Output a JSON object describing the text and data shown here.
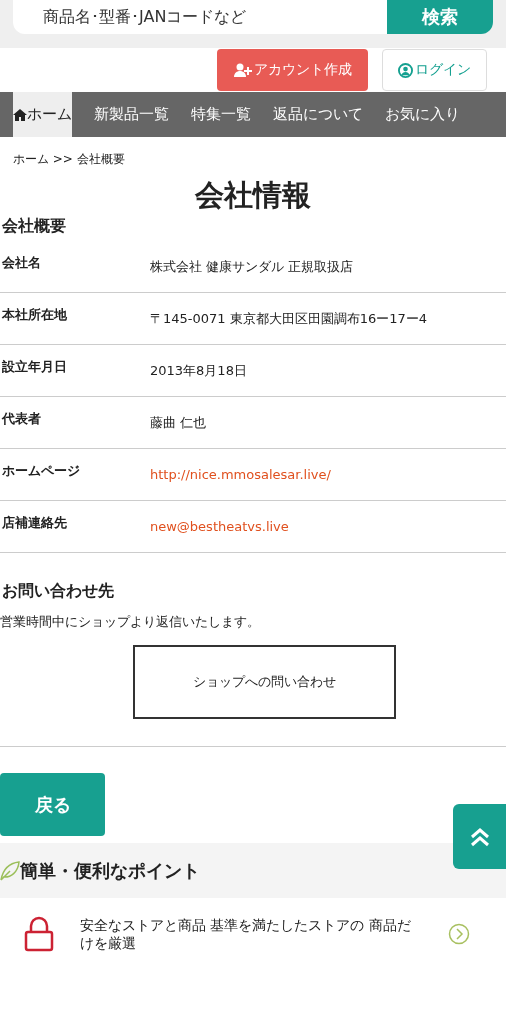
{
  "search": {
    "placeholder": "商品名･型番･JANコードなど",
    "button": "検索"
  },
  "account": {
    "create": "アカウント作成",
    "login": "ログイン"
  },
  "nav": [
    {
      "label": "ホーム",
      "selected": true,
      "icon": true
    },
    {
      "label": "新製品一覧",
      "selected": false
    },
    {
      "label": "特集一覧",
      "selected": false
    },
    {
      "label": "返品について",
      "selected": false
    },
    {
      "label": "お気に入り",
      "selected": false
    }
  ],
  "breadcrumb": "ホーム  >> 会社概要",
  "title": "会社情報",
  "section": "会社概要",
  "rows": [
    {
      "label": "会社名",
      "value": "株式会社 健康サンダル 正規取扱店",
      "kind": "text"
    },
    {
      "label": "本社所在地",
      "value": "〒145-0071 東京都大田区田園調布16ー17ー4",
      "kind": "text"
    },
    {
      "label": "設立年月日",
      "value": "2013年8月18日",
      "kind": "text"
    },
    {
      "label": "代表者",
      "value": "藤曲 仁也",
      "kind": "text"
    },
    {
      "label": "ホームページ",
      "value": "http://nice.mmosalesar.live/",
      "kind": "link"
    },
    {
      "label": "店補連絡先",
      "value": "new@bestheatvs.live",
      "kind": "link"
    }
  ],
  "contact": {
    "title": "お問い合わせ先",
    "text": "営業時間中にショップより返信いたします。",
    "button": "ショップへの問い合わせ"
  },
  "back": "戻る",
  "points": {
    "title": "簡単・便利なポイント",
    "items": [
      {
        "text": "安全なストアと商品 基準を満たしたストアの 商品だけを厳選"
      }
    ]
  }
}
